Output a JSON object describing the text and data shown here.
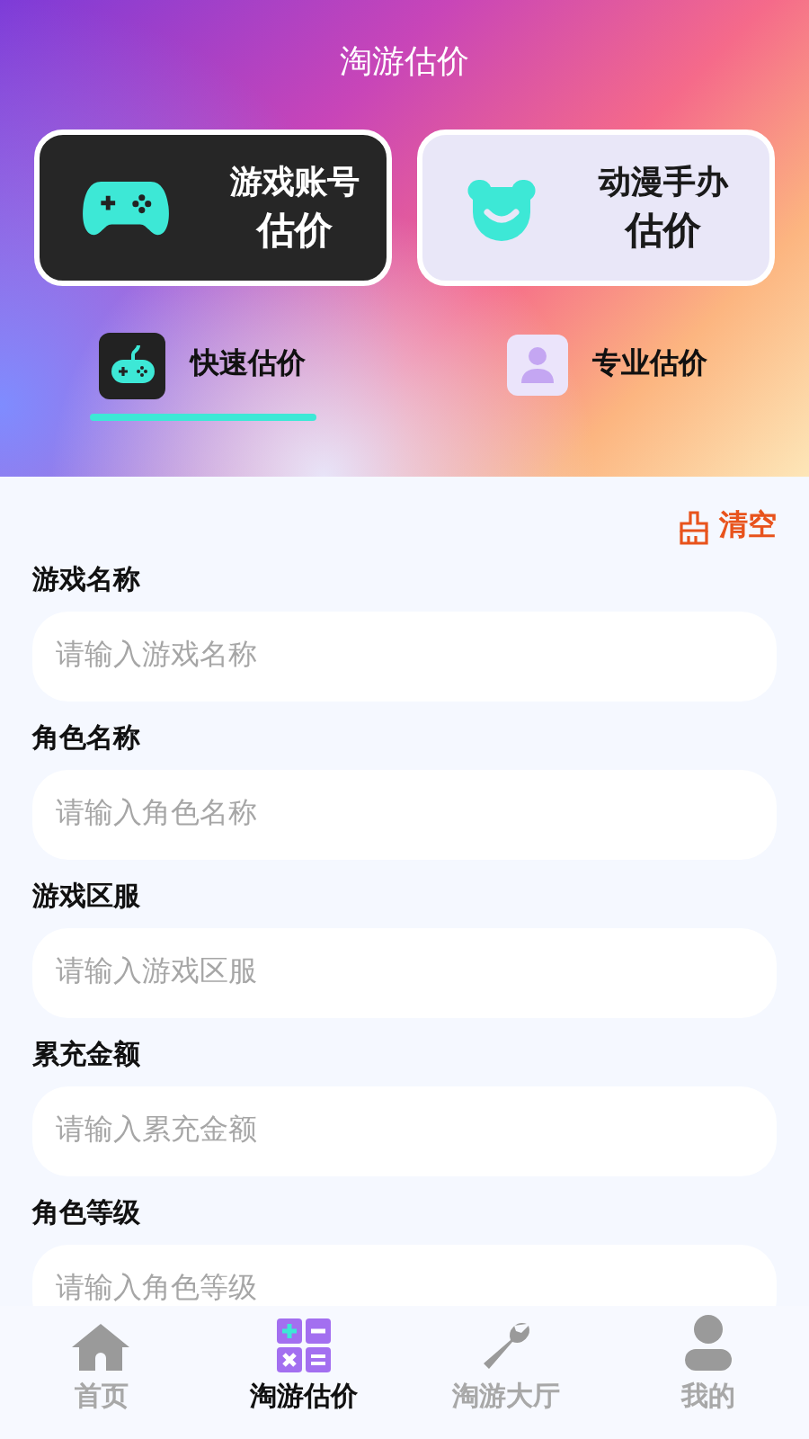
{
  "title": "淘游估价",
  "categories": [
    {
      "kind": "game",
      "line1": "游戏账号",
      "line2": "估价",
      "selected": true
    },
    {
      "kind": "figure",
      "line1": "动漫手办",
      "line2": "估价",
      "selected": false
    }
  ],
  "modes": [
    {
      "kind": "quick",
      "label": "快速估价",
      "selected": true
    },
    {
      "kind": "pro",
      "label": "专业估价",
      "selected": false
    }
  ],
  "clear_button": "清空",
  "fields": [
    {
      "label": "游戏名称",
      "placeholder": "请输入游戏名称"
    },
    {
      "label": "角色名称",
      "placeholder": "请输入角色名称"
    },
    {
      "label": "游戏区服",
      "placeholder": "请输入游戏区服"
    },
    {
      "label": "累充金额",
      "placeholder": "请输入累充金额"
    },
    {
      "label": "角色等级",
      "placeholder": "请输入角色等级"
    }
  ],
  "nav": [
    {
      "kind": "home",
      "label": "首页",
      "selected": false
    },
    {
      "kind": "calc",
      "label": "淘游估价",
      "selected": true
    },
    {
      "kind": "hall",
      "label": "淘游大厅",
      "selected": false
    },
    {
      "kind": "me",
      "label": "我的",
      "selected": false
    }
  ]
}
